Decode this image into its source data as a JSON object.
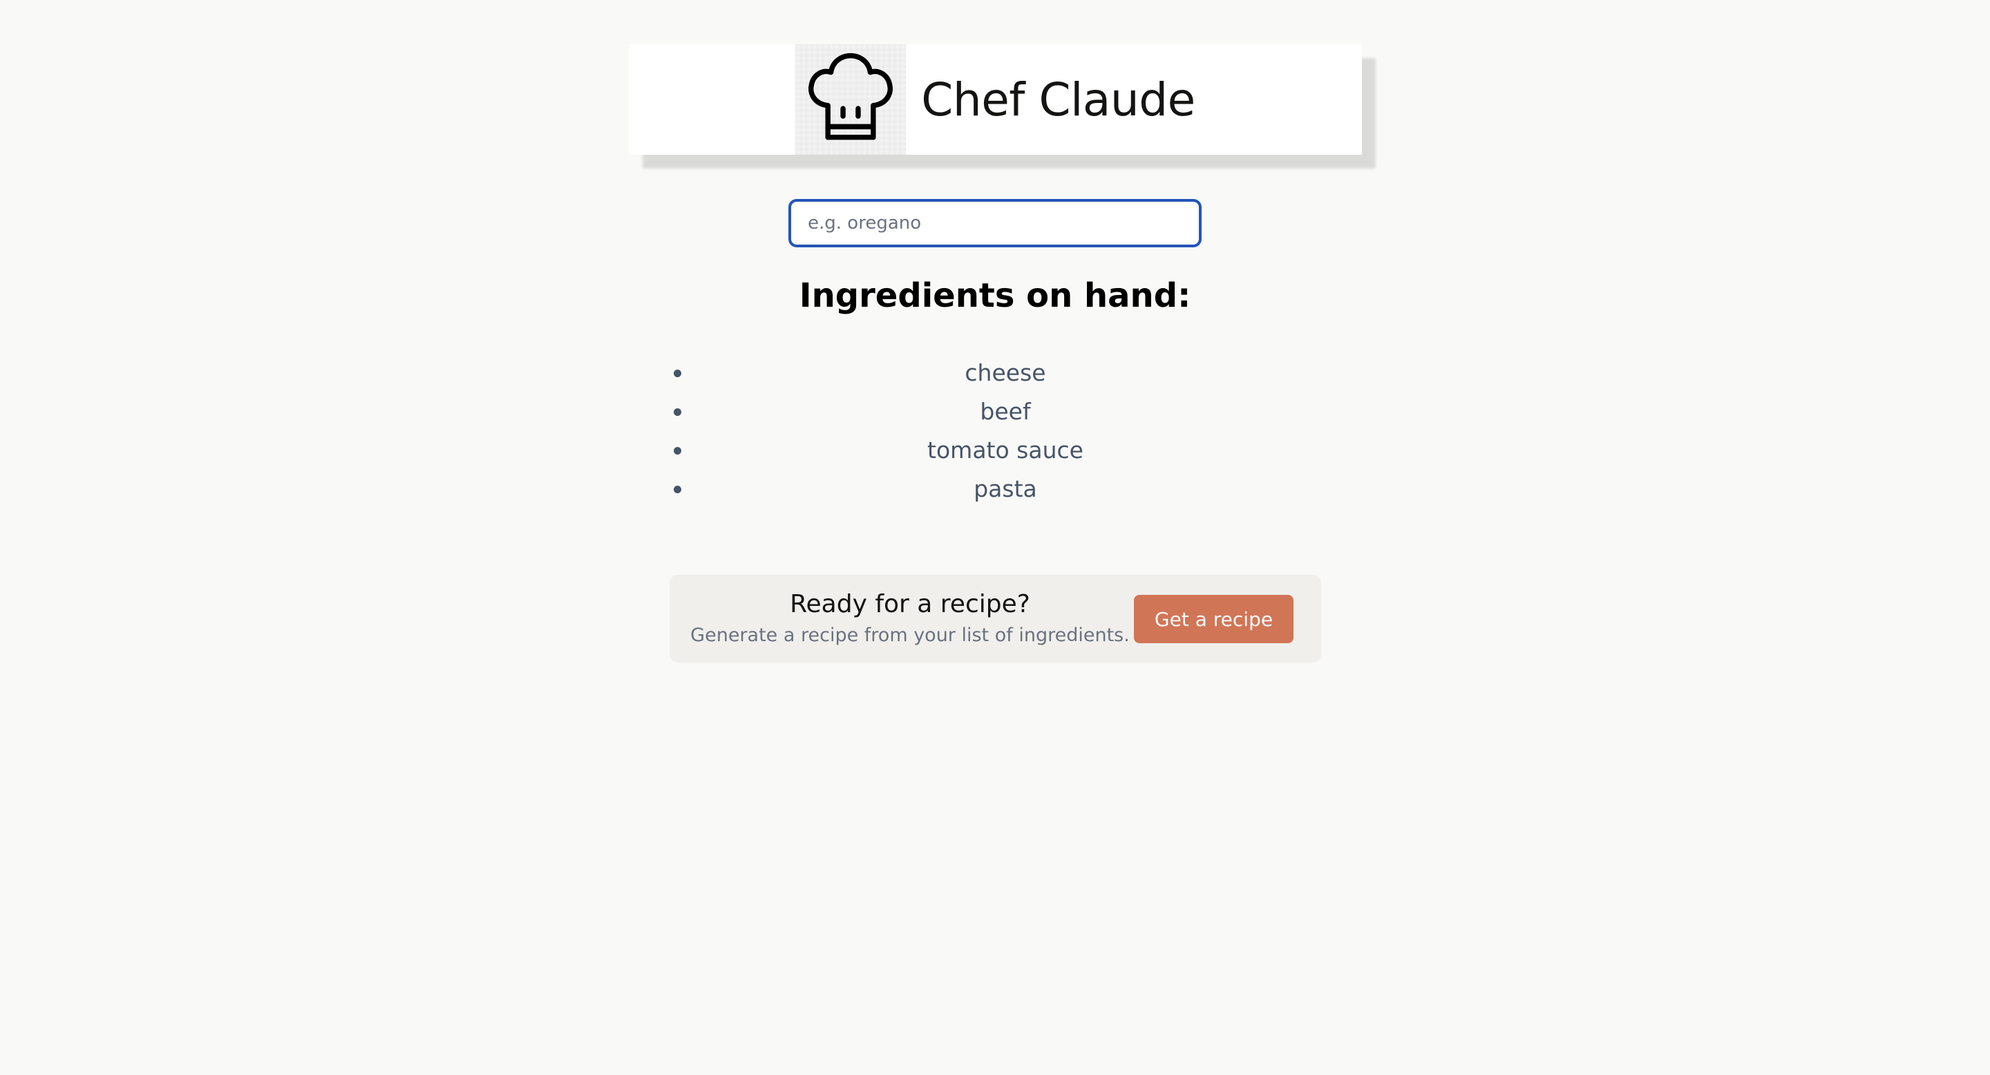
{
  "header": {
    "title": "Chef Claude",
    "logo_icon": "chef-hat-icon"
  },
  "search": {
    "placeholder": "e.g. oregano",
    "value": ""
  },
  "ingredients": {
    "heading": "Ingredients on hand:",
    "items": [
      "cheese",
      "beef",
      "tomato sauce",
      "pasta"
    ]
  },
  "recipe_panel": {
    "title": "Ready for a recipe?",
    "subtitle": "Generate a recipe from your list of ingredients.",
    "button_label": "Get a recipe"
  },
  "colors": {
    "background": "#f9f9f7",
    "accent": "#d17557",
    "input_focus_border": "#2455b8",
    "panel_background": "#f0efeb",
    "list_text": "#475467"
  }
}
